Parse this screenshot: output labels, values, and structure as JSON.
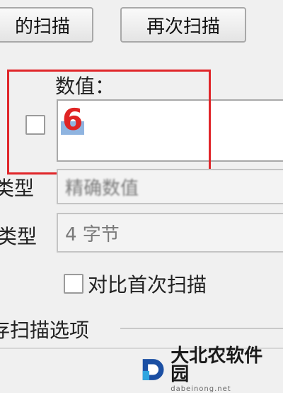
{
  "toolbar": {
    "first_scan_label": "的扫描",
    "next_scan_label": "再次扫描"
  },
  "value_section": {
    "label": "数值：",
    "value": "6"
  },
  "scan_type": {
    "label": "类型",
    "selected": "精确数值"
  },
  "value_type": {
    "label": "类型",
    "selected": "4 字节"
  },
  "compare_first": {
    "label": "对比首次扫描",
    "checked": false
  },
  "scan_options": {
    "label": "存扫描选项"
  },
  "watermark": {
    "title": "大北农软件园",
    "subtitle": "dabeinong.net"
  },
  "colors": {
    "highlight": "#e0262a",
    "value_text": "#e02424"
  }
}
